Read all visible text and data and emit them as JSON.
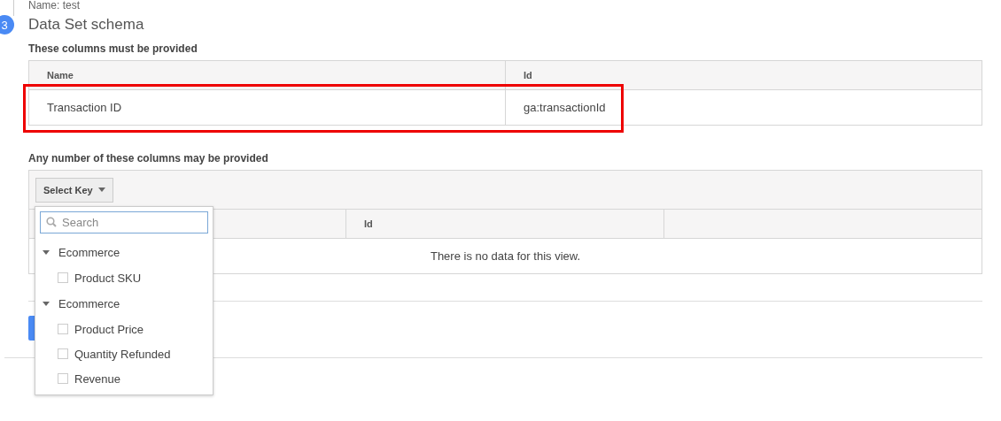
{
  "previous_step": {
    "text": "Name: test"
  },
  "step": {
    "number": "3",
    "title": "Data Set schema"
  },
  "required": {
    "heading": "These columns must be provided",
    "columns": [
      "Name",
      "Id"
    ],
    "rows": [
      [
        "Transaction ID",
        "ga:transactionId"
      ]
    ],
    "highlighted": true
  },
  "optional": {
    "heading": "Any number of these columns may be provided",
    "select_button": "Select Key",
    "columns": [
      "Id"
    ],
    "empty_message": "There is no data for this view."
  },
  "dropdown": {
    "search_placeholder": "Search",
    "groups": [
      {
        "label": "Ecommerce",
        "expanded": true,
        "items": [
          {
            "label": "Product SKU",
            "checked": false
          }
        ]
      },
      {
        "label": "Ecommerce",
        "expanded": true,
        "items": [
          {
            "label": "Product Price",
            "checked": false
          },
          {
            "label": "Quantity Refunded",
            "checked": false
          },
          {
            "label": "Revenue",
            "checked": false
          }
        ]
      }
    ]
  }
}
